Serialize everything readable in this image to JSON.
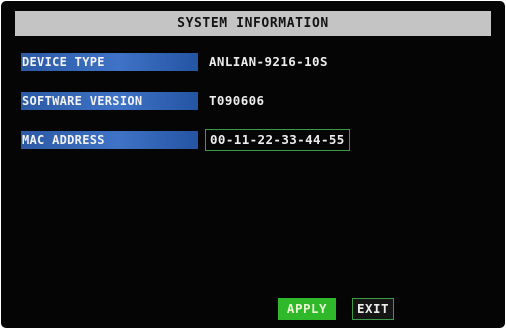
{
  "window": {
    "title": "SYSTEM INFORMATION"
  },
  "fields": [
    {
      "label": "DEVICE TYPE",
      "value": "ANLIAN-9216-10S"
    },
    {
      "label": "SOFTWARE VERSION",
      "value": "T090606"
    },
    {
      "label": "MAC ADDRESS",
      "value": "00-11-22-33-44-55"
    }
  ],
  "buttons": {
    "apply_label": "APPLY",
    "exit_label": "EXIT"
  },
  "colors": {
    "background": "#050505",
    "title_bar": "#c4c4c4",
    "label_fill": "#3f73c7",
    "apply_fill": "#30b82b",
    "focus_border": "#3c9a48"
  }
}
